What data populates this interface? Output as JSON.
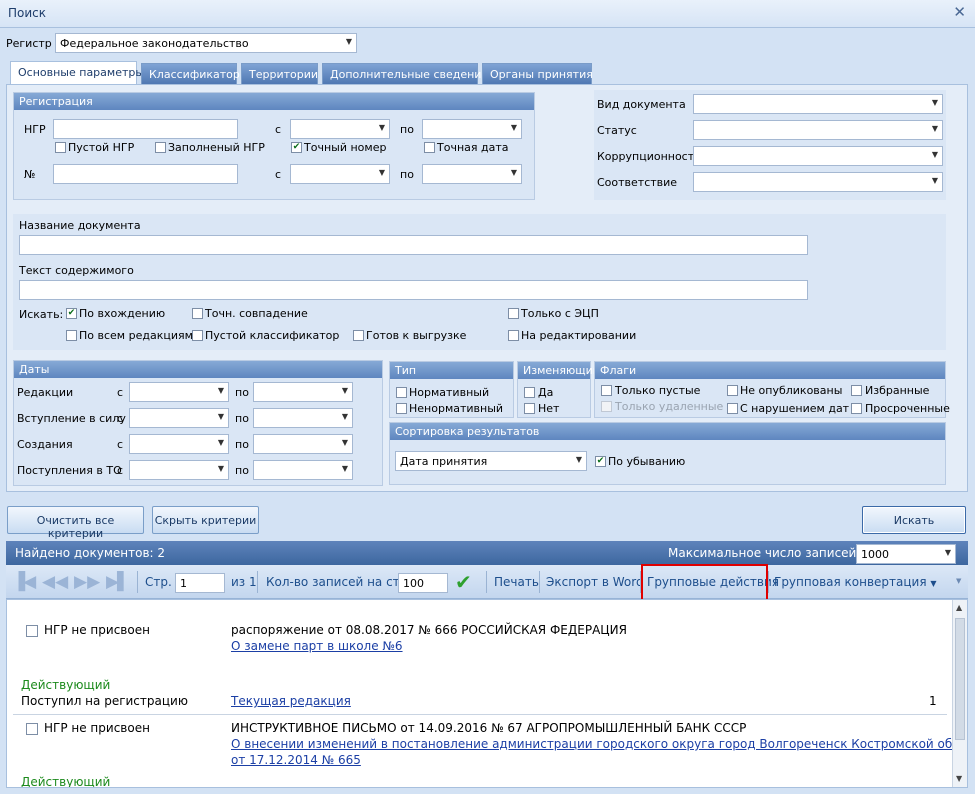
{
  "window": {
    "title": "Поиск"
  },
  "register": {
    "label": "Регистр",
    "value": "Федеральное законодательство"
  },
  "tabs": [
    "Основные параметры",
    "Классификатор",
    "Территории",
    "Дополнительные сведения",
    "Органы принятия"
  ],
  "registration": {
    "title": "Регистрация",
    "ngr_label": "НГР",
    "from_label": "с",
    "to_label": "по",
    "num_label": "№",
    "cb_empty_ngr": "Пустой НГР",
    "cb_filled_ngr": "Заполненый НГР",
    "cb_exact_number": "Точный номер",
    "cb_exact_date": "Точная дата"
  },
  "doc_props": {
    "doc_type": "Вид документа",
    "status": "Статус",
    "corruption": "Коррупционность",
    "conformity": "Соответствие"
  },
  "text_search": {
    "doc_name_label": "Название документа",
    "content_label": "Текст содержимого",
    "search_label": "Искать:",
    "by_occurrence": "По вхождению",
    "exact_match": "Точн. совпадение",
    "only_ecp": "Только с ЭЦП",
    "all_editions": "По всем редакциям",
    "empty_classifier": "Пустой классификатор",
    "ready_export": "Готов к выгрузке",
    "on_editing": "На редактировании"
  },
  "dates": {
    "title": "Даты",
    "rows": [
      "Редакции",
      "Вступление в силу",
      "Создания",
      "Поступления в ТО"
    ],
    "from": "с",
    "to": "по"
  },
  "type_group": {
    "title": "Тип",
    "normative": "Нормативный",
    "non_normative": "Ненормативный"
  },
  "changing_group": {
    "title": "Изменяющий",
    "yes": "Да",
    "no": "Нет"
  },
  "flags_group": {
    "title": "Флаги",
    "only_empty": "Только пустые",
    "only_deleted": "Только удаленные",
    "not_published": "Не опубликованы",
    "date_violation": "С нарушением дат",
    "favorites": "Избранные",
    "overdue": "Просроченные"
  },
  "sort_group": {
    "title": "Сортировка результатов",
    "value": "Дата принятия",
    "descending": "По убыванию"
  },
  "buttons": {
    "clear": "Очистить все критерии",
    "hide": "Скрыть критерии",
    "search": "Искать"
  },
  "results_bar": {
    "found": "Найдено документов: 2",
    "max_label": "Максимальное число записей:",
    "max_value": "1000"
  },
  "nav": {
    "page_label": "Стр.",
    "page_value": "1",
    "of_label": "из 1",
    "per_page_label": "Кол-во записей на стр.",
    "per_page_value": "100",
    "print": "Печать",
    "export_word": "Экспорт в Word",
    "group_actions": "Групповые действия",
    "group_convert": "Групповая конвертация"
  },
  "results": [
    {
      "ngr": "НГР не присвоен",
      "title": "распоряжение от 08.08.2017 № 666 РОССИЙСКАЯ ФЕДЕРАЦИЯ",
      "link": "О замене парт в школе №6",
      "status": "Действующий",
      "registration": "Поступил на регистрацию",
      "edition": "Текущая редакция",
      "count": "1"
    },
    {
      "ngr": "НГР не присвоен",
      "title": "ИНСТРУКТИВНОЕ ПИСЬМО от 14.09.2016 № 67 АГРОПРОМЫШЛЕННЫЙ БАНК СССР",
      "link_line1": "О внесении изменений в постановление администрации городского округа город Волгореченск Костромской области",
      "link_line2": "от 17.12.2014 № 665",
      "status": "Действующий"
    }
  ],
  "colors": {
    "highlight": "#e00000",
    "accent": "#3d679f",
    "status_green": "#1c8a1c"
  }
}
